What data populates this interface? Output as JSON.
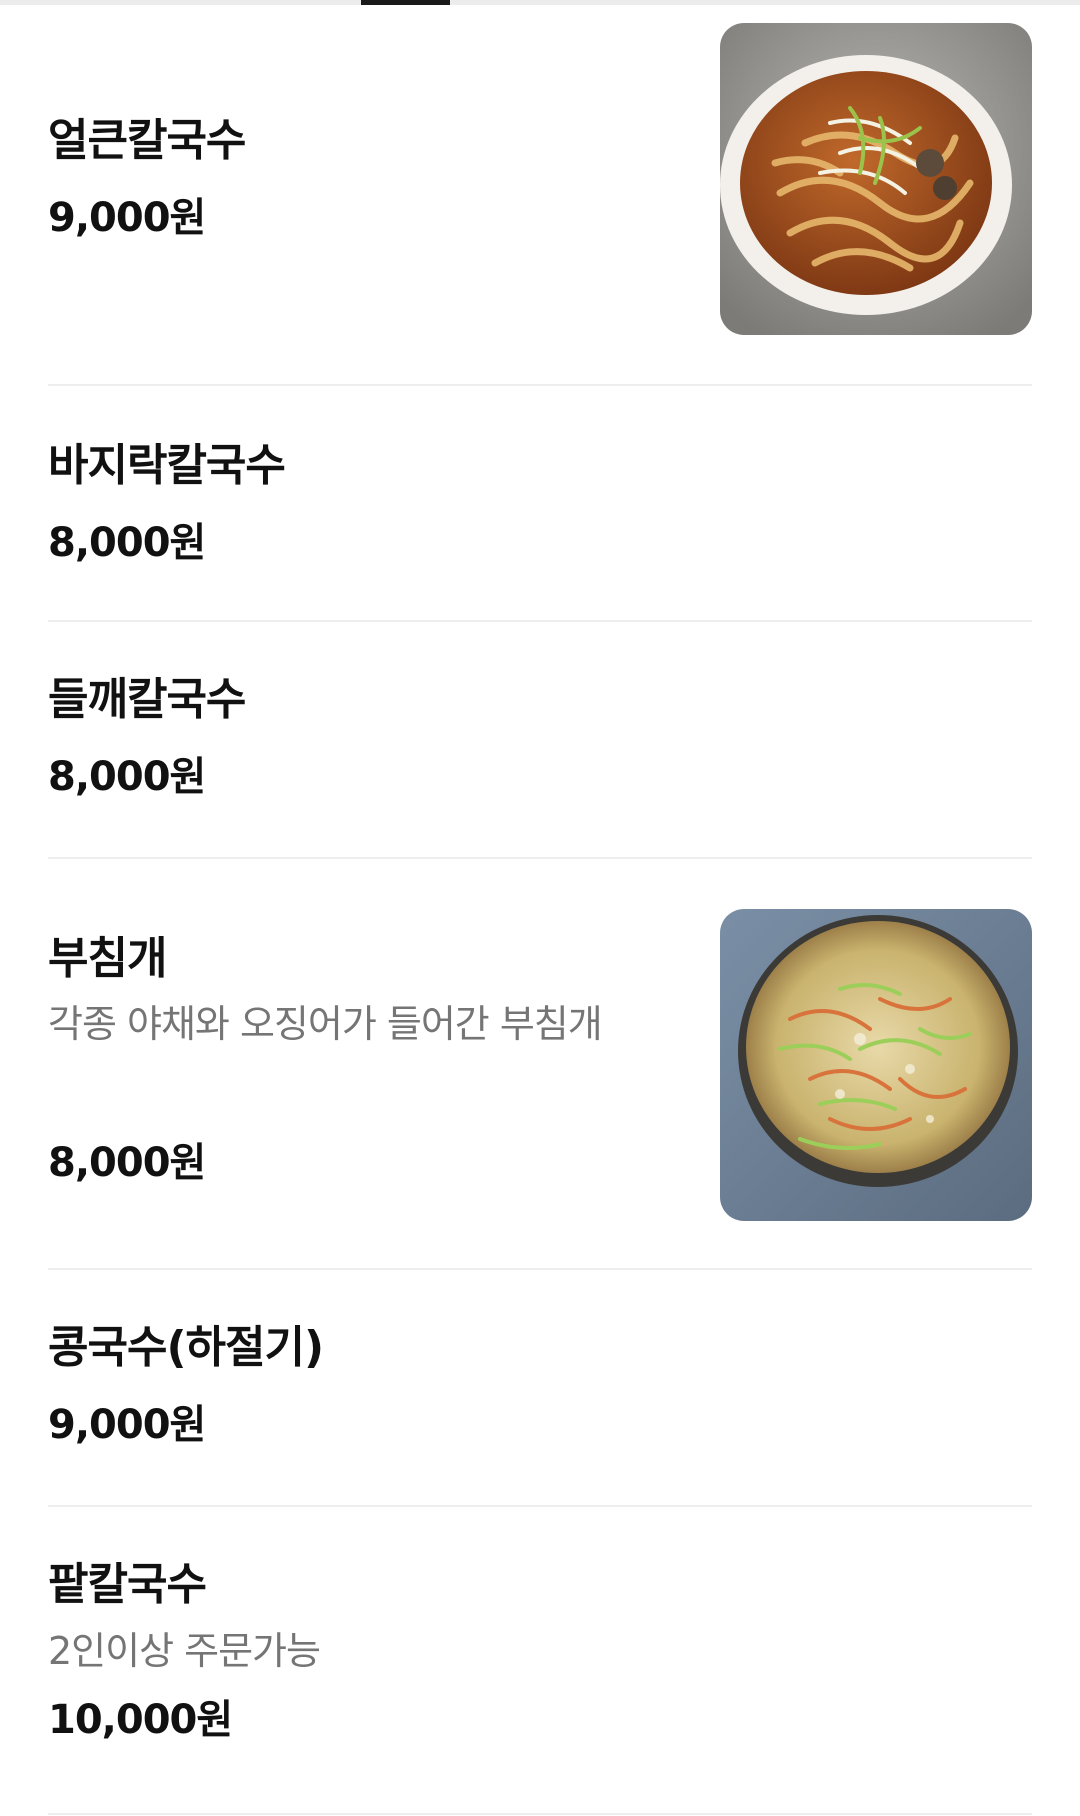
{
  "menu": {
    "items": [
      {
        "name": "얼큰칼국수",
        "description": "",
        "price": "9,000원",
        "has_image": true,
        "image": "noodle-soup-photo"
      },
      {
        "name": "바지락칼국수",
        "description": "",
        "price": "8,000원",
        "has_image": false
      },
      {
        "name": "들깨칼국수",
        "description": "",
        "price": "8,000원",
        "has_image": false
      },
      {
        "name": "부침개",
        "description": "각종 야채와 오징어가 들어간 부침개",
        "price": "8,000원",
        "has_image": true,
        "image": "pancake-photo"
      },
      {
        "name": "콩국수(하절기)",
        "description": "",
        "price": "9,000원",
        "has_image": false
      },
      {
        "name": "팥칼국수",
        "description": "2인이상 주문가능",
        "price": "10,000원",
        "has_image": false
      }
    ]
  },
  "colors": {
    "text_primary": "#111111",
    "text_secondary": "#757575",
    "divider": "#eeeeee",
    "tab_indicator": "#1a1a1a"
  }
}
